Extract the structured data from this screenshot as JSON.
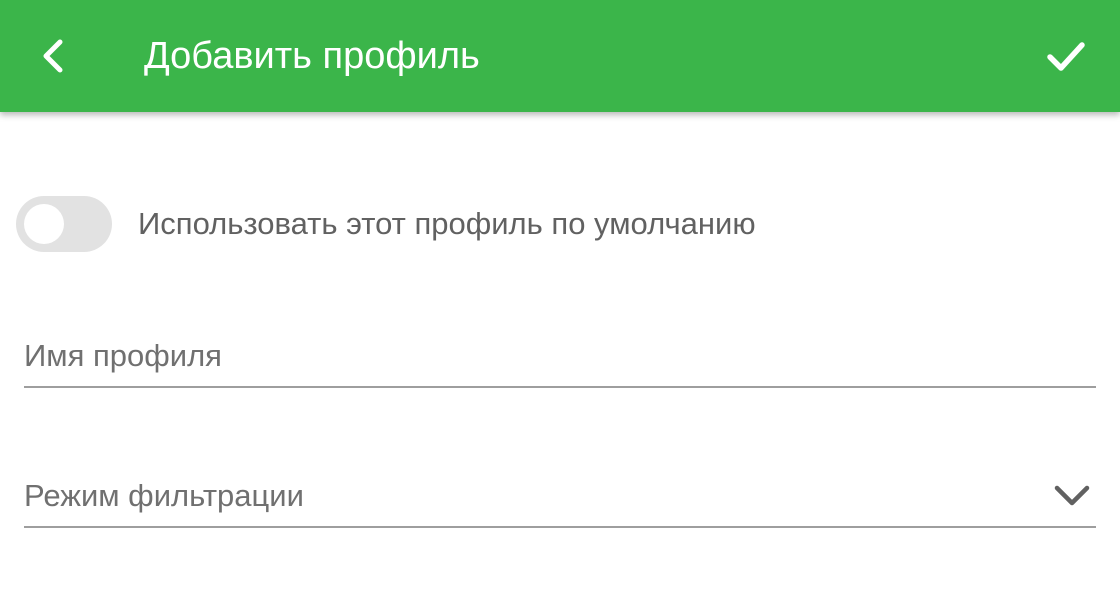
{
  "appbar": {
    "title": "Добавить профиль",
    "back_icon": "arrow-back-icon",
    "confirm_icon": "check-icon",
    "background_color": "#3bb54a"
  },
  "form": {
    "default_toggle": {
      "label": "Использовать этот профиль по умолчанию",
      "checked": false
    },
    "profile_name": {
      "placeholder": "Имя профиля",
      "value": ""
    },
    "filter_mode": {
      "label": "Режим фильтрации",
      "icon": "chevron-down-icon"
    }
  }
}
